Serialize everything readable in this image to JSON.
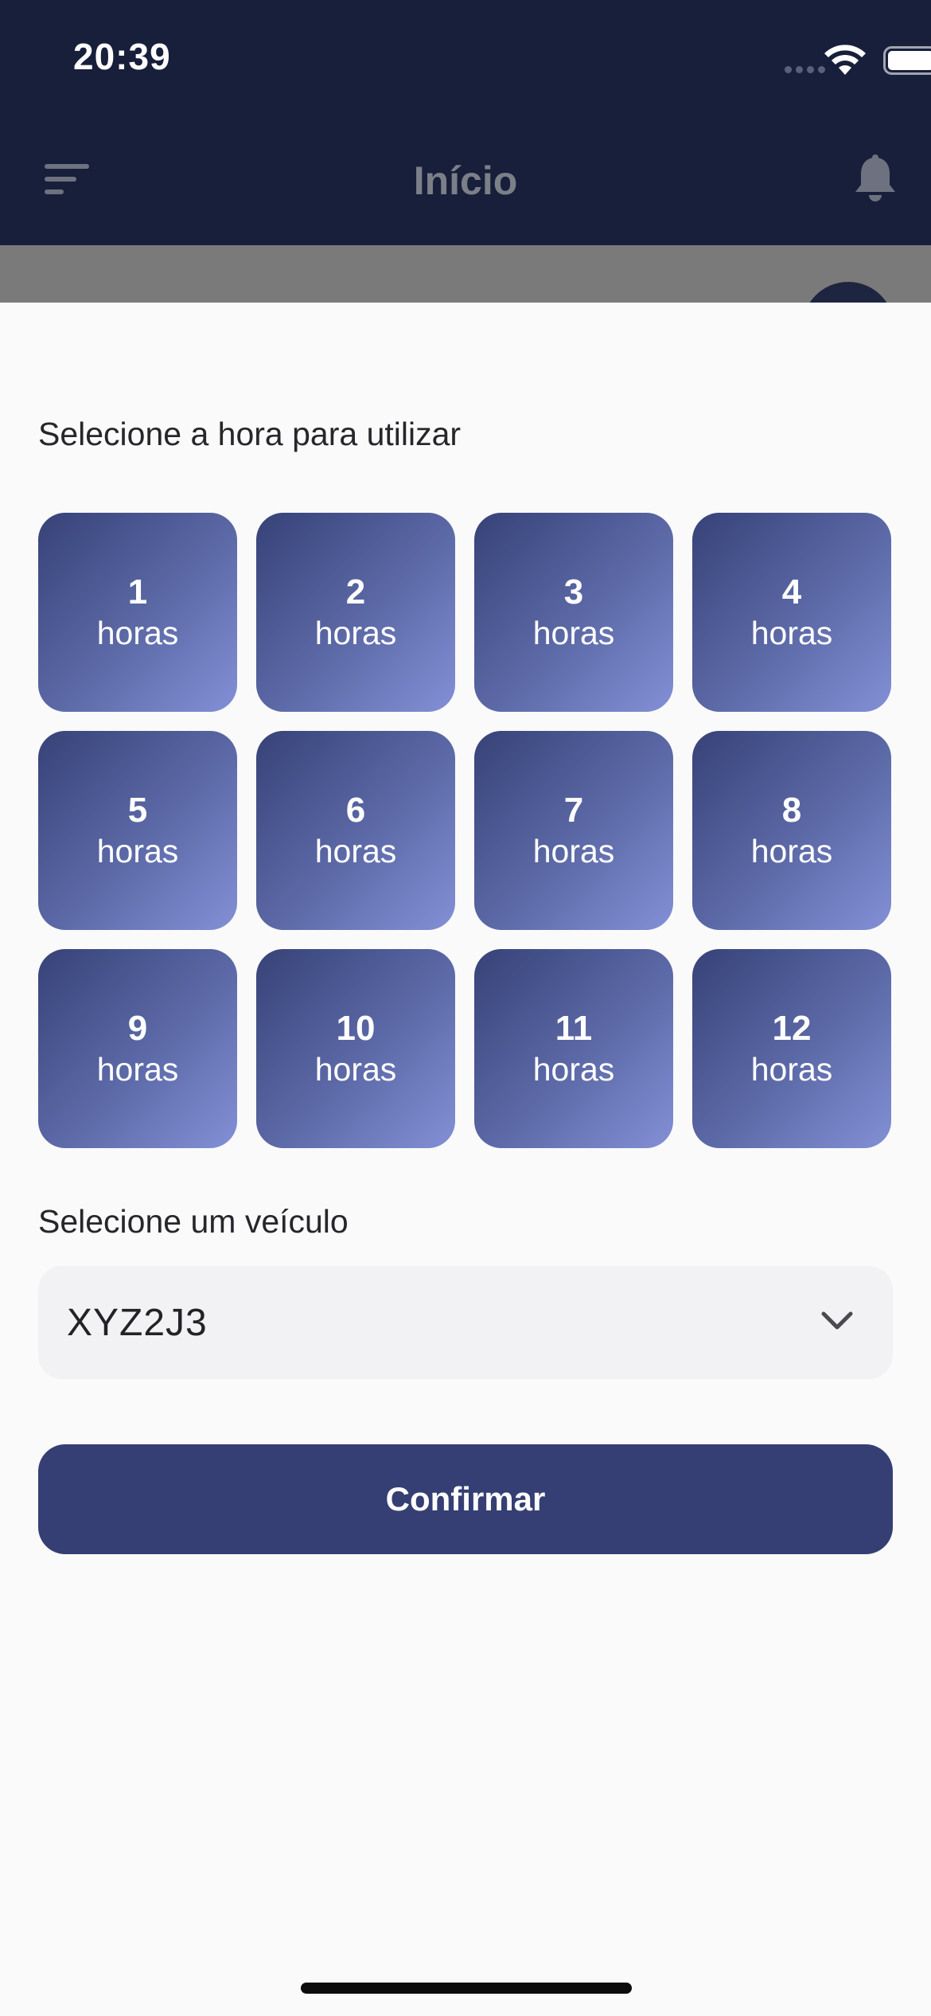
{
  "status_bar": {
    "time": "20:39"
  },
  "nav": {
    "title": "Início"
  },
  "sheet": {
    "hours_label": "Selecione a hora para utilizar",
    "hour_unit": "horas",
    "hours": [
      "1",
      "2",
      "3",
      "4",
      "5",
      "6",
      "7",
      "8",
      "9",
      "10",
      "11",
      "12"
    ],
    "vehicle_label": "Selecione um veículo",
    "vehicle_selected": "XYZ2J3",
    "confirm_label": "Confirmar"
  },
  "colors": {
    "header_bg": "#181f3b",
    "button_gradient_start": "#364277",
    "button_gradient_end": "#8390d6",
    "confirm_bg": "#353f74"
  }
}
